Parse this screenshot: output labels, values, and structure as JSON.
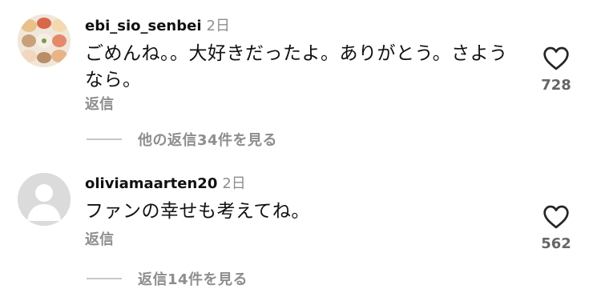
{
  "comments": [
    {
      "username": "ebi_sio_senbei",
      "time": "2日",
      "text": "ごめんね。。大好きだったよ。ありがとう。さようなら。",
      "reply_label": "返信",
      "likes": "728",
      "view_replies": "他の返信34件を見る",
      "avatar": "food-photo-avatar"
    },
    {
      "username": "oliviamaarten20",
      "time": "2日",
      "text": "ファンの幸せも考えてね。",
      "reply_label": "返信",
      "likes": "562",
      "view_replies": "返信14件を見る",
      "avatar": "default-user-avatar"
    }
  ],
  "icons": {
    "like": "heart-outline-icon"
  },
  "colors": {
    "secondary_text": "#8e8e8e",
    "primary_text": "#111111",
    "divider": "#c7c7c7"
  }
}
